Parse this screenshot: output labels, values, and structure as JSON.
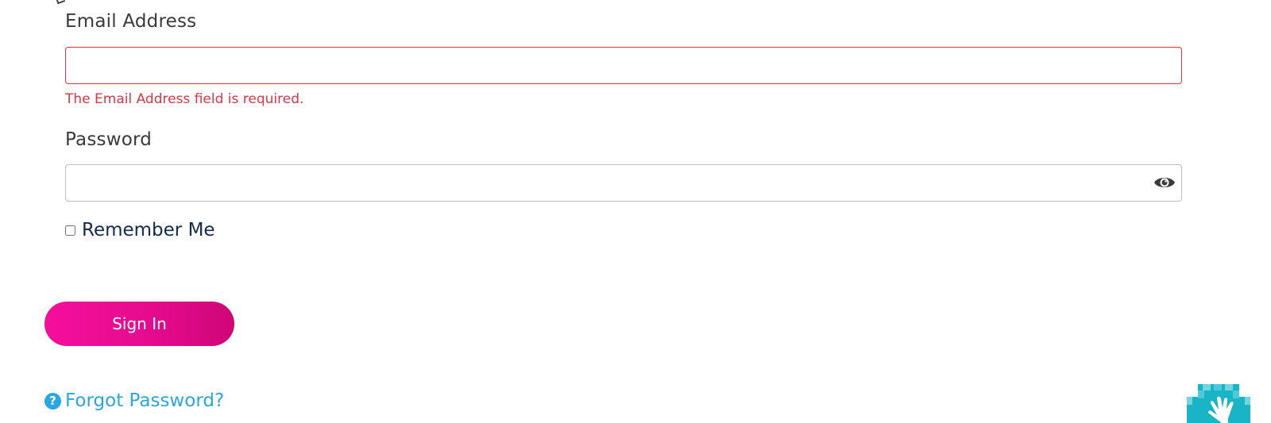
{
  "form": {
    "email": {
      "label": "Email Address",
      "value": "",
      "placeholder": "",
      "error": "The Email Address field is required."
    },
    "password": {
      "label": "Password",
      "value": "",
      "placeholder": ""
    },
    "remember": {
      "label": "Remember Me",
      "checked": false
    },
    "submit_label": "Sign In",
    "forgot_label": "Forgot Password?"
  },
  "icons": {
    "password_toggle": "eye-icon",
    "forgot": "question-circle-icon",
    "help_widget": "hand-icon"
  },
  "colors": {
    "error": "#dc3545",
    "accent": "#e60b8e",
    "link": "#2aa7e0",
    "widget": "#1bb3c4"
  }
}
